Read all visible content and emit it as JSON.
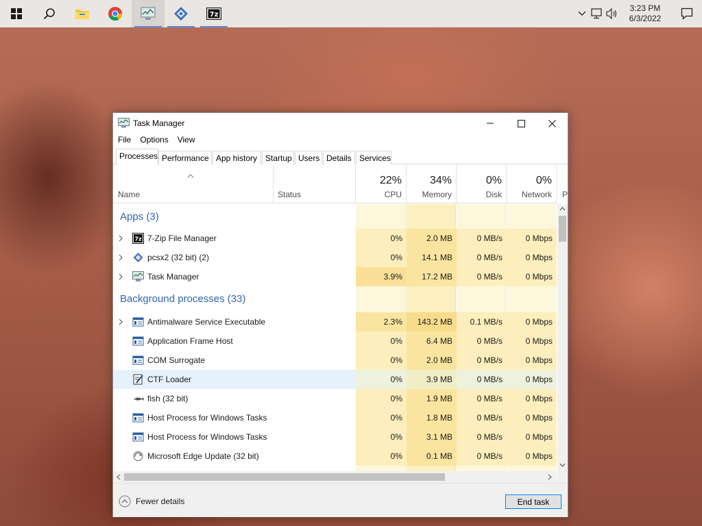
{
  "taskbar": {
    "clock_time": "3:23 PM",
    "clock_date": "6/3/2022",
    "apps": [
      "start",
      "search",
      "file-explorer",
      "chrome",
      "task-manager",
      "pcsx2",
      "7-zip"
    ]
  },
  "window": {
    "title": "Task Manager",
    "menu": [
      "File",
      "Options",
      "View"
    ],
    "tabs": [
      "Processes",
      "Performance",
      "App history",
      "Startup",
      "Users",
      "Details",
      "Services"
    ],
    "selected_tab": "Processes"
  },
  "header": {
    "name_label": "Name",
    "status_label": "Status",
    "cpu_pct": "22%",
    "cpu_label": "CPU",
    "memory_pct": "34%",
    "memory_label": "Memory",
    "disk_pct": "0%",
    "disk_label": "Disk",
    "network_pct": "0%",
    "network_label": "Network",
    "power_label": "P"
  },
  "groups": {
    "apps": "Apps (3)",
    "background": "Background processes (33)"
  },
  "apps": [
    {
      "name": "7-Zip File Manager",
      "cpu": "0%",
      "memory": "2.0 MB",
      "disk": "0 MB/s",
      "network": "0 Mbps",
      "icon": "7zip-icon"
    },
    {
      "name": "pcsx2 (32 bit) (2)",
      "cpu": "0%",
      "memory": "14.1 MB",
      "disk": "0 MB/s",
      "network": "0 Mbps",
      "icon": "pcsx2-icon"
    },
    {
      "name": "Task Manager",
      "cpu": "3.9%",
      "memory": "17.2 MB",
      "disk": "0 MB/s",
      "network": "0 Mbps",
      "icon": "task-manager-icon"
    }
  ],
  "background": [
    {
      "name": "Antimalware Service Executable",
      "cpu": "2.3%",
      "memory": "143.2 MB",
      "disk": "0.1 MB/s",
      "network": "0 Mbps",
      "icon": "service-window-icon"
    },
    {
      "name": "Application Frame Host",
      "cpu": "0%",
      "memory": "6.4 MB",
      "disk": "0 MB/s",
      "network": "0 Mbps",
      "icon": "service-window-icon"
    },
    {
      "name": "COM Surrogate",
      "cpu": "0%",
      "memory": "2.0 MB",
      "disk": "0 MB/s",
      "network": "0 Mbps",
      "icon": "service-window-icon"
    },
    {
      "name": "CTF Loader",
      "cpu": "0%",
      "memory": "3.9 MB",
      "disk": "0 MB/s",
      "network": "0 Mbps",
      "icon": "ctf-loader-icon"
    },
    {
      "name": "fish (32 bit)",
      "cpu": "0%",
      "memory": "1.9 MB",
      "disk": "0 MB/s",
      "network": "0 Mbps",
      "icon": "fish-icon"
    },
    {
      "name": "Host Process for Windows Tasks",
      "cpu": "0%",
      "memory": "1.8 MB",
      "disk": "0 MB/s",
      "network": "0 Mbps",
      "icon": "service-window-icon"
    },
    {
      "name": "Host Process for Windows Tasks",
      "cpu": "0%",
      "memory": "3.1 MB",
      "disk": "0 MB/s",
      "network": "0 Mbps",
      "icon": "service-window-icon"
    },
    {
      "name": "Microsoft Edge Update (32 bit)",
      "cpu": "0%",
      "memory": "0.1 MB",
      "disk": "0 MB/s",
      "network": "0 Mbps",
      "icon": "edge-update-icon"
    }
  ],
  "footer": {
    "fewer_details": "Fewer details",
    "end_task": "End task"
  },
  "colors": {
    "group_text": "#2f67ad",
    "heat_light": "#fdf6d8",
    "heat_medium": "#fbecb2",
    "heat_strong": "#f9e39a",
    "selection": "#e5f1fb"
  }
}
